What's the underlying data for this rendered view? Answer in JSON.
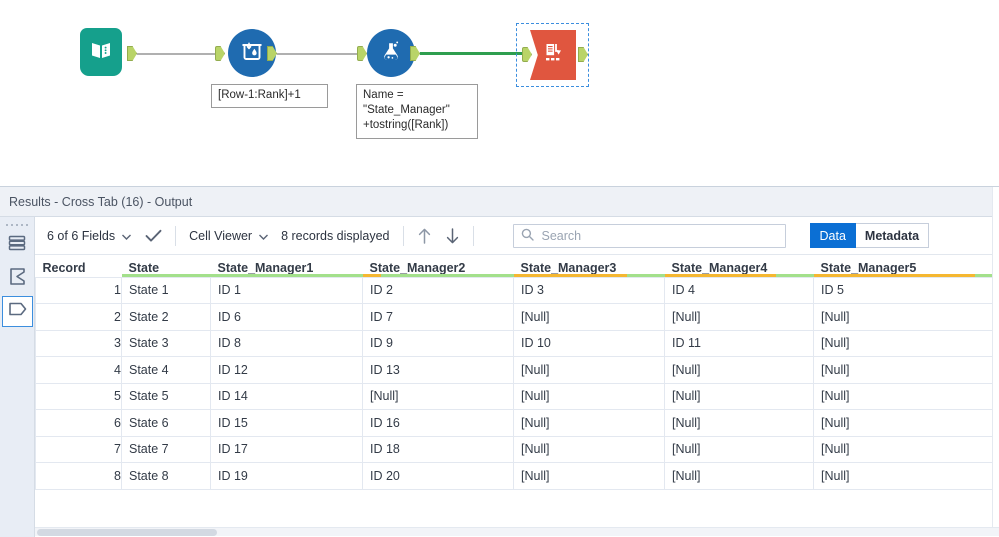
{
  "workflow": {
    "tools": [
      {
        "name": "text-input-tool",
        "icon": "book-icon",
        "annotation": ""
      },
      {
        "name": "multi-row-formula-tool",
        "icon": "water-bucket-icon",
        "annotation": "[Row-1:Rank]+1"
      },
      {
        "name": "formula-tool",
        "icon": "flask-icon",
        "annotation": "Name =\n\"State_Manager\"\n+tostring([Rank])"
      },
      {
        "name": "cross-tab-tool",
        "icon": "cross-tab-icon",
        "annotation": ""
      }
    ],
    "annotations": {
      "multi_row_formula": "[Row-1:Rank]+1",
      "formula_line1": "Name =",
      "formula_line2": "\"State_Manager\"",
      "formula_line3": "+tostring([Rank])"
    },
    "colors": {
      "text_input": "#15a08c",
      "blue_tool": "#1f6bb0",
      "cross_tab": "#e0563f",
      "anchor": "#b9d468",
      "connection": "#b0b0b0",
      "active_connection": "#2e9e4f",
      "selection": "#3c8ede"
    }
  },
  "results": {
    "title": "Results - Cross Tab (16) - Output",
    "rail": [
      {
        "name": "rows-view-icon",
        "label": "Rows"
      },
      {
        "name": "summary-sigma-icon",
        "label": "Summary"
      },
      {
        "name": "tag-profile-icon",
        "label": "Profile",
        "selected": true
      }
    ],
    "toolbar": {
      "fields_label": "6 of 6 Fields",
      "check_icon": "checkmark-icon",
      "cell_viewer_label": "Cell Viewer",
      "records_label": "8 records displayed",
      "up_arrow_icon": "arrow-up-icon",
      "down_arrow_icon": "arrow-down-icon",
      "search_icon": "search-icon",
      "search_value": "",
      "search_placeholder": "Search",
      "data_tab": "Data",
      "metadata_tab": "Metadata",
      "active_tab": "Data"
    },
    "grid": {
      "columns": [
        {
          "key": "record",
          "label": "Record",
          "null_pct": 0
        },
        {
          "key": "state",
          "label": "State",
          "null_pct": 0
        },
        {
          "key": "sm1",
          "label": "State_Manager1",
          "null_pct": 0
        },
        {
          "key": "sm2",
          "label": "State_Manager2",
          "null_pct": 12.5
        },
        {
          "key": "sm3",
          "label": "State_Manager3",
          "null_pct": 75
        },
        {
          "key": "sm4",
          "label": "State_Manager4",
          "null_pct": 75
        },
        {
          "key": "sm5",
          "label": "State_Manager5",
          "null_pct": 87.5
        }
      ],
      "null_text": "[Null]",
      "rows": [
        {
          "record": "1",
          "state": "State 1",
          "sm1": "ID 1",
          "sm2": "ID 2",
          "sm3": "ID 3",
          "sm4": "ID 4",
          "sm5": "ID 5"
        },
        {
          "record": "2",
          "state": "State 2",
          "sm1": "ID 6",
          "sm2": "ID 7",
          "sm3": "[Null]",
          "sm4": "[Null]",
          "sm5": "[Null]"
        },
        {
          "record": "3",
          "state": "State 3",
          "sm1": "ID 8",
          "sm2": "ID 9",
          "sm3": "ID 10",
          "sm4": "ID 11",
          "sm5": "[Null]"
        },
        {
          "record": "4",
          "state": "State 4",
          "sm1": "ID 12",
          "sm2": "ID 13",
          "sm3": "[Null]",
          "sm4": "[Null]",
          "sm5": "[Null]"
        },
        {
          "record": "5",
          "state": "State 5",
          "sm1": "ID 14",
          "sm2": "[Null]",
          "sm3": "[Null]",
          "sm4": "[Null]",
          "sm5": "[Null]"
        },
        {
          "record": "6",
          "state": "State 6",
          "sm1": "ID 15",
          "sm2": "ID 16",
          "sm3": "[Null]",
          "sm4": "[Null]",
          "sm5": "[Null]"
        },
        {
          "record": "7",
          "state": "State 7",
          "sm1": "ID 17",
          "sm2": "ID 18",
          "sm3": "[Null]",
          "sm4": "[Null]",
          "sm5": "[Null]"
        },
        {
          "record": "8",
          "state": "State 8",
          "sm1": "ID 19",
          "sm2": "ID 20",
          "sm3": "[Null]",
          "sm4": "[Null]",
          "sm5": "[Null]"
        }
      ]
    },
    "colors": {
      "accent_blue": "#0b6fd4",
      "null_text": "#a9b2c0",
      "quality_ok": "#a3e08b",
      "quality_null": "#f5b731",
      "header_bg": "#eef1f6"
    }
  }
}
